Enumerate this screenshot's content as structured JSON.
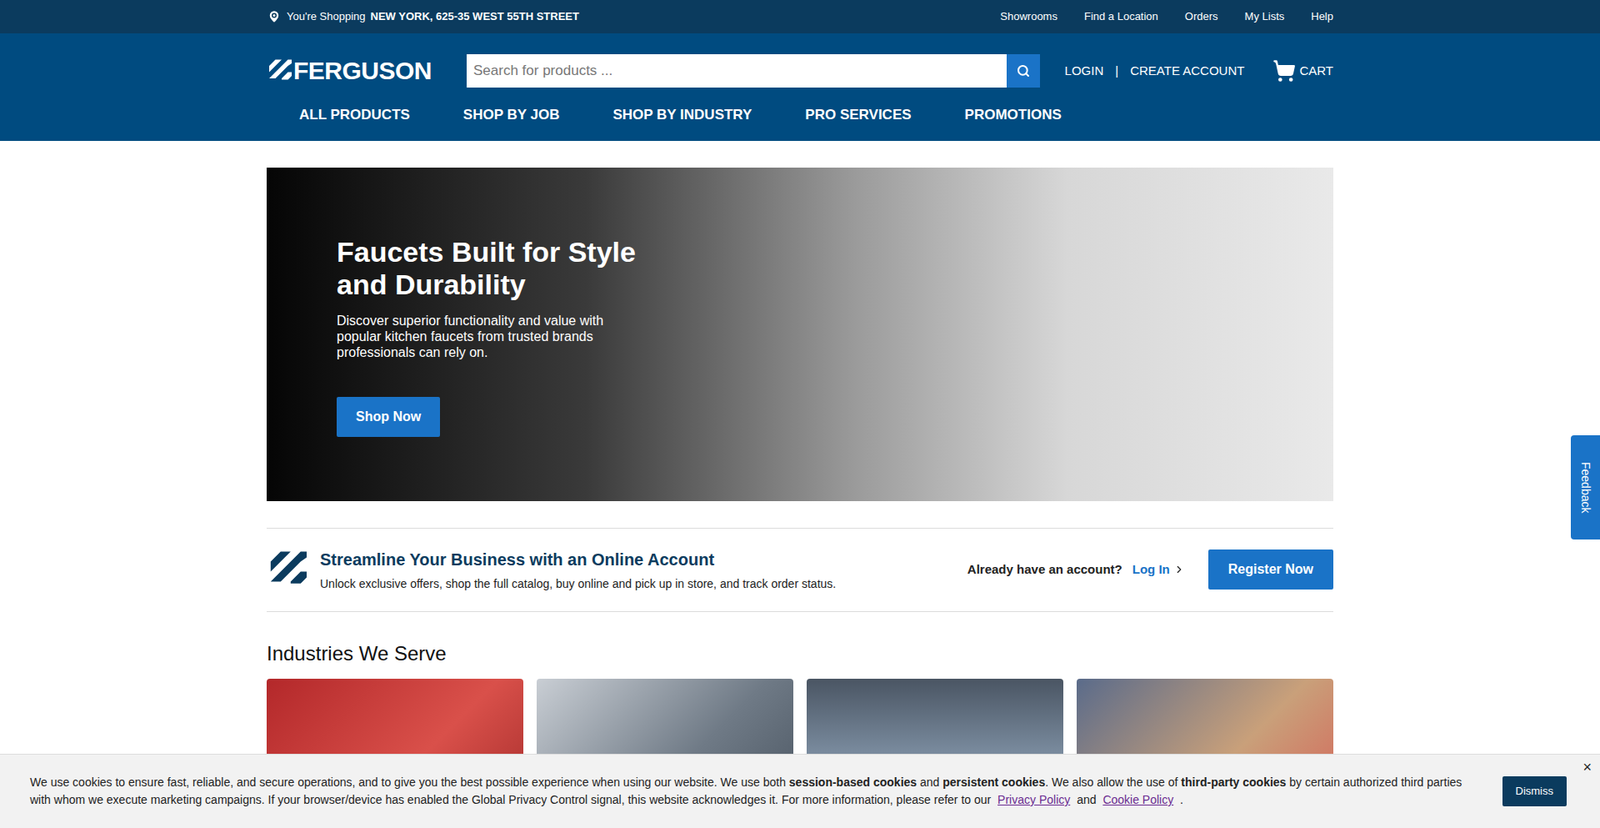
{
  "topbar": {
    "location_prefix": "You're Shopping",
    "location": "NEW YORK, 625-35 WEST 55TH STREET",
    "links": [
      "Showrooms",
      "Find a Location",
      "Orders",
      "My Lists",
      "Help"
    ]
  },
  "header": {
    "logo": "FERGUSON",
    "search": {
      "placeholder": "Search for products ..."
    },
    "login": "LOGIN",
    "separator": "|",
    "create_account": "CREATE ACCOUNT",
    "cart": "CART"
  },
  "nav": [
    "ALL PRODUCTS",
    "SHOP BY JOB",
    "SHOP BY INDUSTRY",
    "PRO SERVICES",
    "PROMOTIONS"
  ],
  "hero": {
    "title": "Faucets Built for Style and Durability",
    "text": "Discover superior functionality and value with popular kitchen faucets from trusted brands professionals can rely on.",
    "button": "Shop Now"
  },
  "account_banner": {
    "title": "Streamline Your Business with an Online Account",
    "text": "Unlock exclusive offers, shop the full catalog, buy online and pick up in store, and track order status.",
    "prompt": "Already have an account?",
    "login": "Log In",
    "register": "Register Now"
  },
  "industries": {
    "title": "Industries We Serve",
    "cards": [
      {
        "kind": "photo"
      },
      {
        "kind": "photo"
      },
      {
        "kind": "photo"
      },
      {
        "kind": "photo"
      }
    ]
  },
  "cookie_banner": {
    "segments": [
      {
        "text": "We use cookies to ensure fast, reliable, and secure operations, and to give you the best possible experience when using our website. We use both ",
        "kind": "plain"
      },
      {
        "text": "session-based cookies",
        "kind": "bold"
      },
      {
        "text": " and ",
        "kind": "plain"
      },
      {
        "text": "persistent cookies",
        "kind": "bold"
      },
      {
        "text": ". We also allow the use of ",
        "kind": "plain"
      },
      {
        "text": "third-party cookies",
        "kind": "bold"
      },
      {
        "text": " by certain authorized third parties with whom we execute marketing campaigns. If your browser/device has enabled the Global Privacy Control signal, this website acknowledges it. For more information, please refer to our ",
        "kind": "plain"
      },
      {
        "text": "Privacy Policy",
        "kind": "link"
      },
      {
        "text": " and ",
        "kind": "plain"
      },
      {
        "text": "Cookie Policy",
        "kind": "link"
      },
      {
        "text": " .",
        "kind": "plain"
      }
    ],
    "dismiss": "Dismiss",
    "close": "×"
  },
  "feedback": "Feedback"
}
